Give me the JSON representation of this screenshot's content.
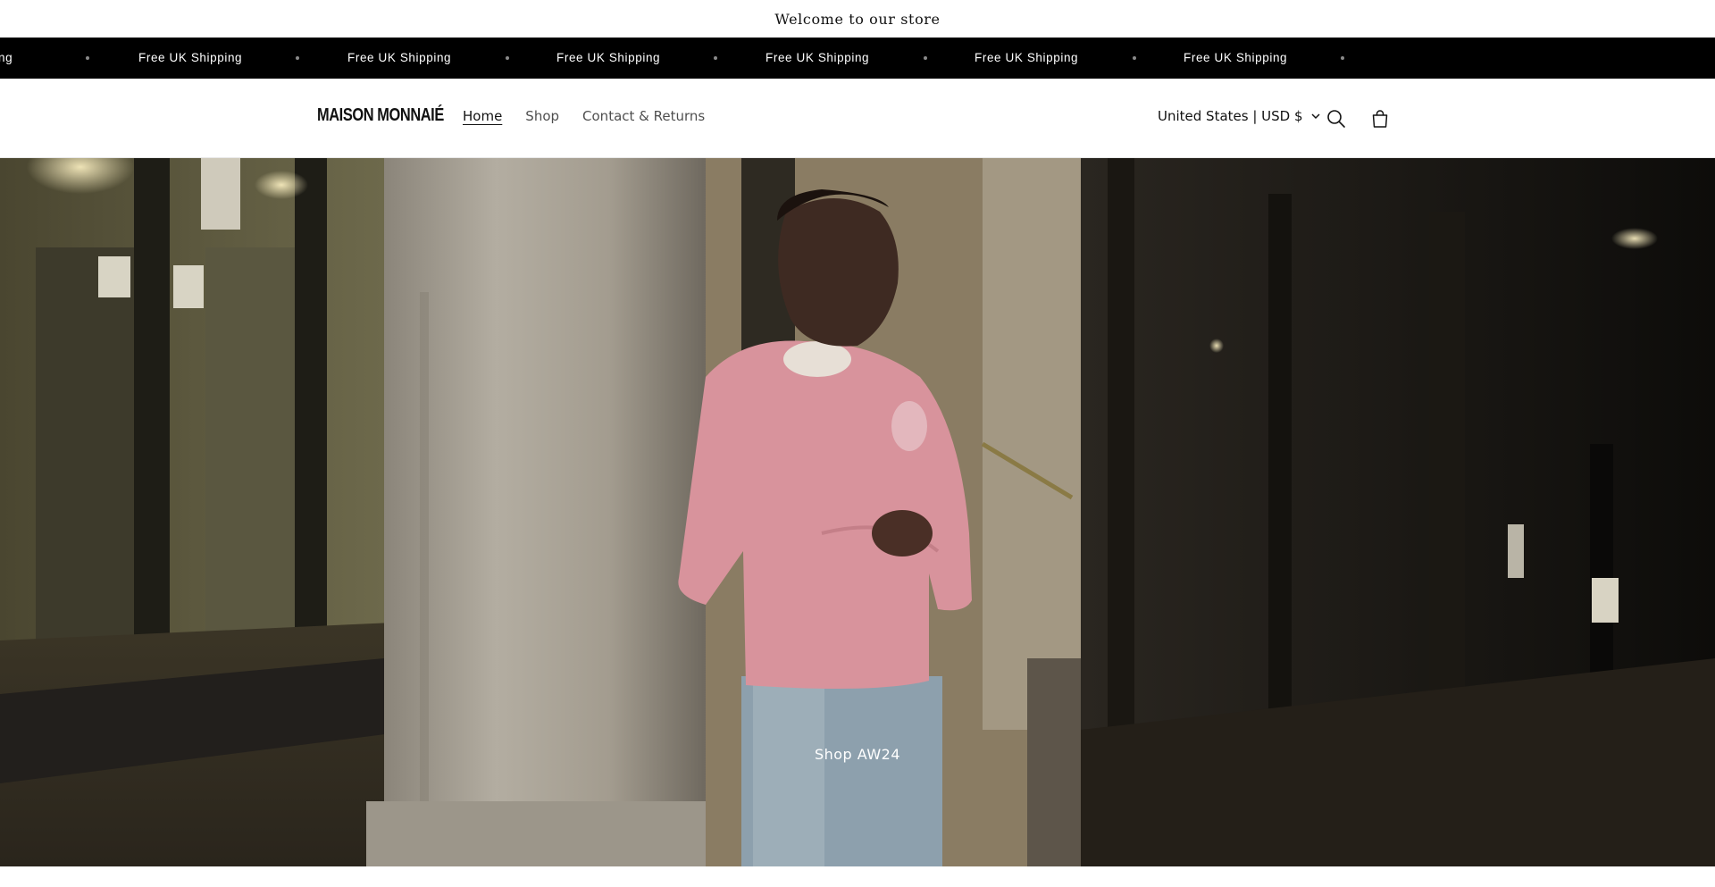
{
  "announcement": {
    "text": "Welcome to our store"
  },
  "marquee": {
    "partial_text": "ng",
    "item_text": "Free UK Shipping",
    "items": [
      "Free UK Shipping",
      "Free UK Shipping",
      "Free UK Shipping",
      "Free UK Shipping",
      "Free UK Shipping",
      "Free UK Shipping"
    ]
  },
  "header": {
    "logo": "MAISON MONNAIÉ",
    "nav": [
      {
        "label": "Home",
        "active": true
      },
      {
        "label": "Shop",
        "active": false
      },
      {
        "label": "Contact & Returns",
        "active": false
      }
    ],
    "country_selector": "United States | USD $",
    "icons": [
      "search-icon",
      "cart-icon",
      "chevron-down-icon"
    ]
  },
  "hero": {
    "cta_label": "Shop AW24"
  },
  "colors": {
    "marquee_bg": "#000000",
    "marquee_text": "#ffffff",
    "header_bg": "#ffffff",
    "sweater_pink": "#d8939c"
  }
}
